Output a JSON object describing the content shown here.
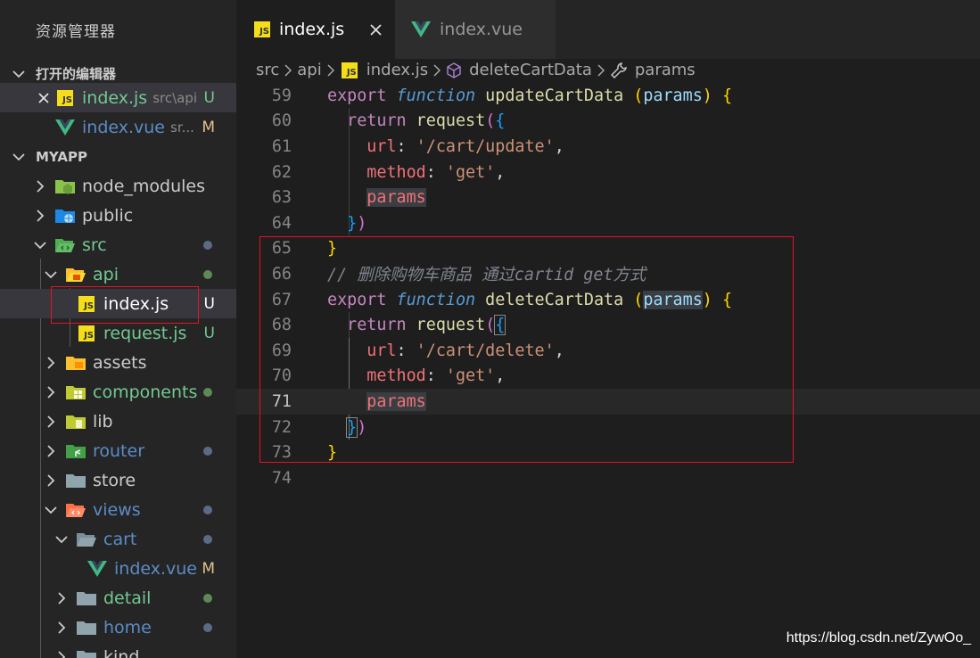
{
  "sidebar": {
    "title": "资源管理器",
    "open_editors": {
      "header": "打开的编辑器",
      "items": [
        {
          "name": "index.js",
          "path": "src\\api",
          "badge": "U"
        },
        {
          "name": "index.vue",
          "path": "sr...",
          "badge": "M"
        }
      ]
    },
    "project": {
      "header": "MYAPP",
      "items": [
        {
          "name": "node_modules"
        },
        {
          "name": "public"
        },
        {
          "name": "src"
        },
        {
          "name": "api"
        },
        {
          "name": "index.js",
          "badge": "U"
        },
        {
          "name": "request.js",
          "badge": "U"
        },
        {
          "name": "assets"
        },
        {
          "name": "components"
        },
        {
          "name": "lib"
        },
        {
          "name": "router"
        },
        {
          "name": "store"
        },
        {
          "name": "views"
        },
        {
          "name": "cart"
        },
        {
          "name": "index.vue",
          "badge": "M"
        },
        {
          "name": "detail"
        },
        {
          "name": "home"
        },
        {
          "name": "kind"
        }
      ]
    }
  },
  "tabs": [
    {
      "label": "index.js",
      "active": true
    },
    {
      "label": "index.vue",
      "active": false
    }
  ],
  "breadcrumb": [
    "src",
    "api",
    "index.js",
    "deleteCartData",
    "params"
  ],
  "code_lines": [
    {
      "n": "59",
      "t": "export function updateCartData (params) {"
    },
    {
      "n": "60",
      "t": "  return request({"
    },
    {
      "n": "61",
      "t": "    url: '/cart/update',"
    },
    {
      "n": "62",
      "t": "    method: 'get',"
    },
    {
      "n": "63",
      "t": "    params"
    },
    {
      "n": "64",
      "t": "  })"
    },
    {
      "n": "65",
      "t": "}"
    },
    {
      "n": "66",
      "t": "// 删除购物车商品 通过cartid get方式"
    },
    {
      "n": "67",
      "t": "export function deleteCartData (params) {"
    },
    {
      "n": "68",
      "t": "  return request({"
    },
    {
      "n": "69",
      "t": "    url: '/cart/delete',"
    },
    {
      "n": "70",
      "t": "    method: 'get',"
    },
    {
      "n": "71",
      "t": "    params"
    },
    {
      "n": "72",
      "t": "  })"
    },
    {
      "n": "73",
      "t": "}"
    },
    {
      "n": "74",
      "t": ""
    }
  ],
  "watermark": "https://blog.csdn.net/ZywOo_",
  "colors": {
    "sidebar_bg": "#252526",
    "editor_bg": "#1e1e1e",
    "annotation_box": "#e81123",
    "untracked_badge": "#73c991",
    "modified_badge": "#e2c08d"
  }
}
